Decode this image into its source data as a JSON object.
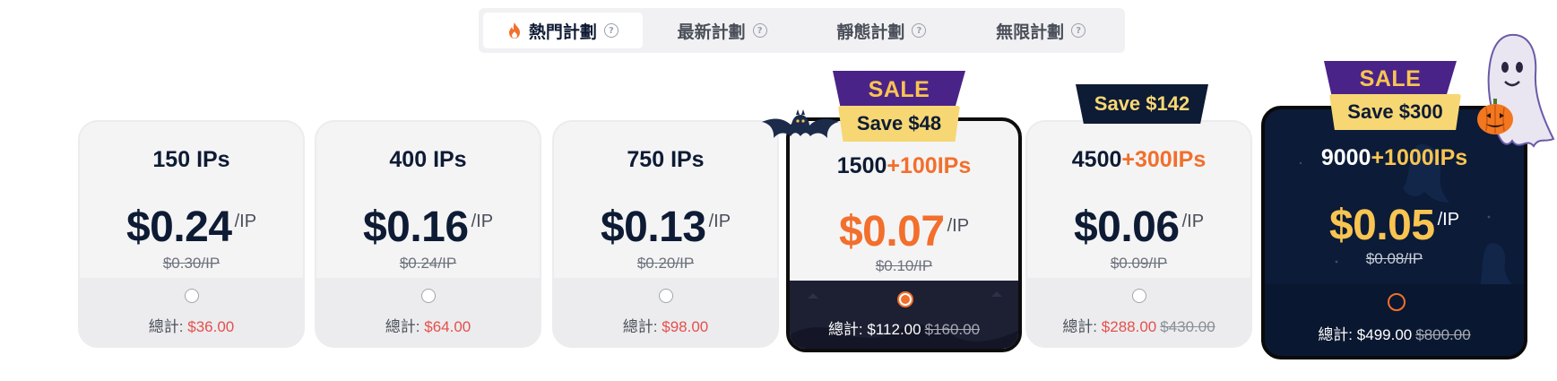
{
  "tabs": [
    {
      "label": "熱門計劃",
      "icon": "fire-icon",
      "active": true
    },
    {
      "label": "最新計劃",
      "icon": "question-icon",
      "active": false
    },
    {
      "label": "靜態計劃",
      "icon": "question-icon",
      "active": false
    },
    {
      "label": "無限計劃",
      "icon": "question-icon",
      "active": false
    }
  ],
  "help_glyph": "?",
  "plans": [
    {
      "title": "150 IPs",
      "bonus": "",
      "price": "$0.24",
      "unit": "/IP",
      "old": "$0.30/IP",
      "total_label": "總計:",
      "total": "$36.00",
      "total_old": ""
    },
    {
      "title": "400 IPs",
      "bonus": "",
      "price": "$0.16",
      "unit": "/IP",
      "old": "$0.24/IP",
      "total_label": "總計:",
      "total": "$64.00",
      "total_old": ""
    },
    {
      "title": "750 IPs",
      "bonus": "",
      "price": "$0.13",
      "unit": "/IP",
      "old": "$0.20/IP",
      "total_label": "總計:",
      "total": "$98.00",
      "total_old": ""
    },
    {
      "title": "1500",
      "bonus": "+100IPs",
      "price": "$0.07",
      "unit": "/IP",
      "old": "$0.10/IP",
      "total_label": "總計:",
      "total": "$112.00",
      "total_old": "$160.00",
      "selected": true,
      "sale": "SALE",
      "save": "Save $48"
    },
    {
      "title": "4500",
      "bonus": "+300IPs",
      "price": "$0.06",
      "unit": "/IP",
      "old": "$0.09/IP",
      "total_label": "總計:",
      "total": "$288.00",
      "total_old": "$430.00",
      "save": "Save $142"
    },
    {
      "title": "9000",
      "bonus": "+1000IPs",
      "price": "$0.05",
      "unit": "/IP",
      "old": "$0.08/IP",
      "total_label": "總計:",
      "total": "$499.00",
      "total_old": "$800.00",
      "sale": "SALE",
      "save": "Save $300"
    }
  ],
  "colors": {
    "accent": "#f26f2c",
    "navy": "#0e1b34",
    "gold": "#f9c451",
    "sale_purple": "#4a2388",
    "price_red": "#e4504d"
  }
}
